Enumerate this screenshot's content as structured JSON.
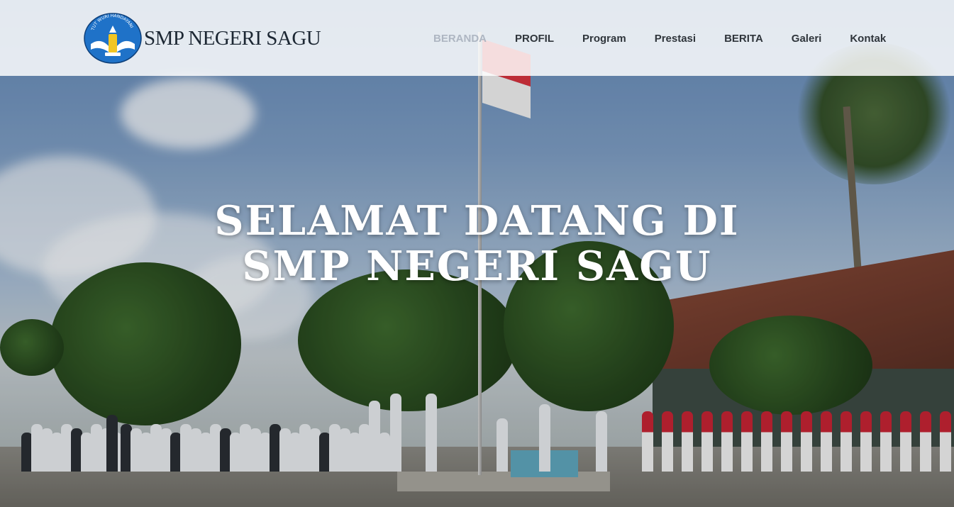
{
  "site": {
    "logo_icon": "tut-wuri-handayani-logo",
    "logo_text": "TUT WURI HANDAYANI",
    "title": "SMP NEGERI SAGU"
  },
  "nav": {
    "items": [
      {
        "label": "BERANDA",
        "active": true
      },
      {
        "label": "PROFIL",
        "active": false
      },
      {
        "label": "Program",
        "active": false
      },
      {
        "label": "Prestasi",
        "active": false
      },
      {
        "label": "BERITA",
        "active": false
      },
      {
        "label": "Galeri",
        "active": false
      },
      {
        "label": "Kontak",
        "active": false
      }
    ]
  },
  "hero": {
    "line1": "SELAMAT DATANG DI",
    "line2": "SMP NEGERI SAGU",
    "background": "school-flag-ceremony-photo"
  },
  "colors": {
    "nav_active": "#aeb6c2",
    "nav_text": "#2f353b",
    "logo_blue": "#1f72c8"
  }
}
